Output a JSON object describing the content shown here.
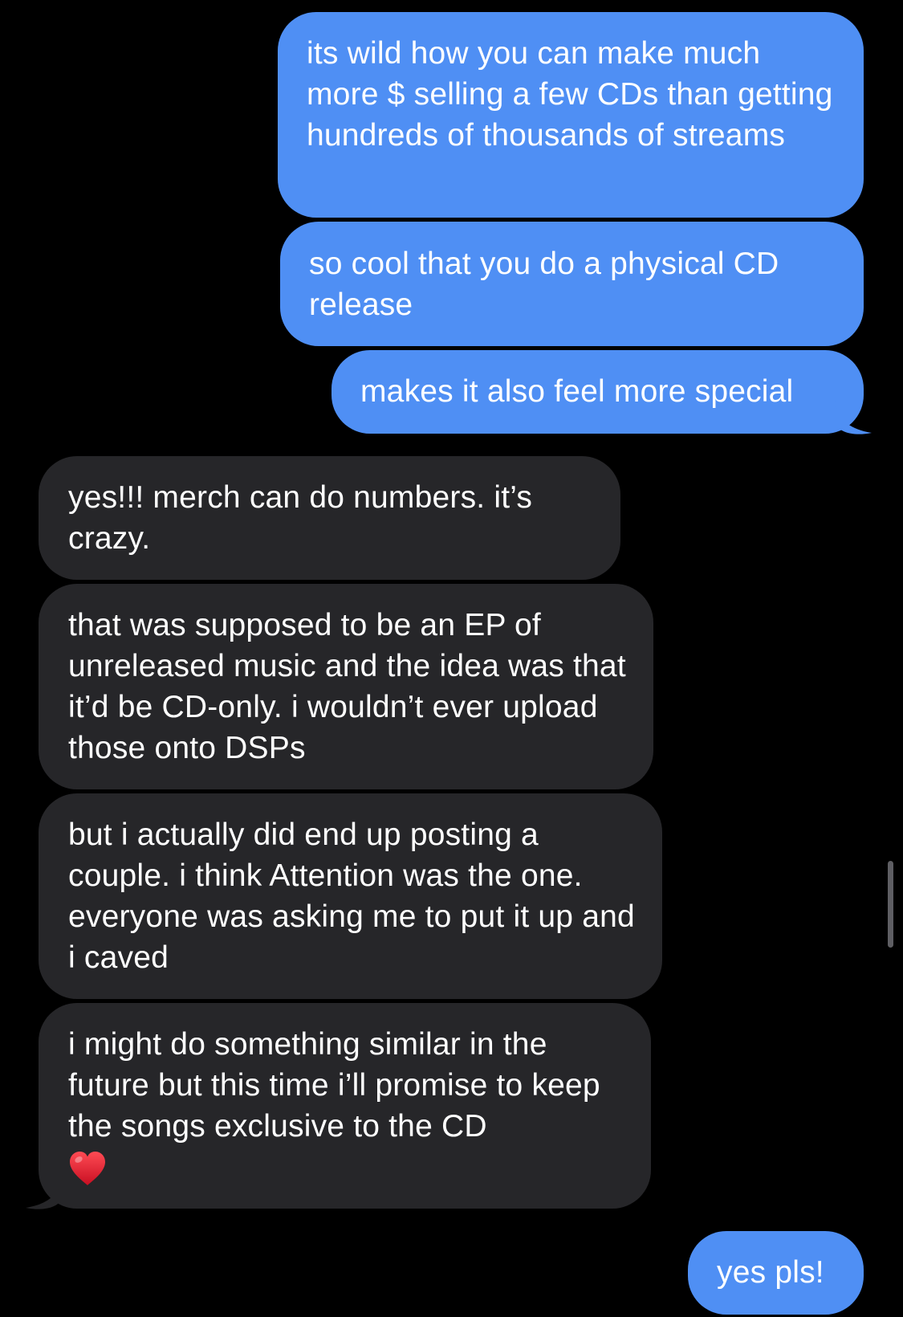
{
  "conversation": {
    "messages": [
      {
        "direction": "sent",
        "text": "its wild how you can make much more $ selling a few CDs than getting hundreds of thousands of streams"
      },
      {
        "direction": "sent",
        "text": "so cool that you do a physical CD release"
      },
      {
        "direction": "sent",
        "text": "makes it also feel more special"
      },
      {
        "direction": "received",
        "text": "yes!!! merch can do numbers. it’s crazy."
      },
      {
        "direction": "received",
        "text": "that was supposed to be an EP of unreleased music and the idea was that it’d be CD-only. i wouldn’t ever upload those onto DSPs"
      },
      {
        "direction": "received",
        "text": "but i actually did end up posting a couple. i think Attention was the one. everyone was asking me to put it up and i caved"
      },
      {
        "direction": "received",
        "text": "i might do something similar in the future but this time i’ll promise to keep the songs exclusive to the CD",
        "emoji": "heart-icon"
      },
      {
        "direction": "sent",
        "text": "yes pls!"
      }
    ]
  },
  "colors": {
    "background": "#000000",
    "sent_bubble": "#4f8ff4",
    "received_bubble": "#262629",
    "text": "#ffffff",
    "heart": "#e0182b",
    "scroll_indicator": "#5e5e63"
  }
}
